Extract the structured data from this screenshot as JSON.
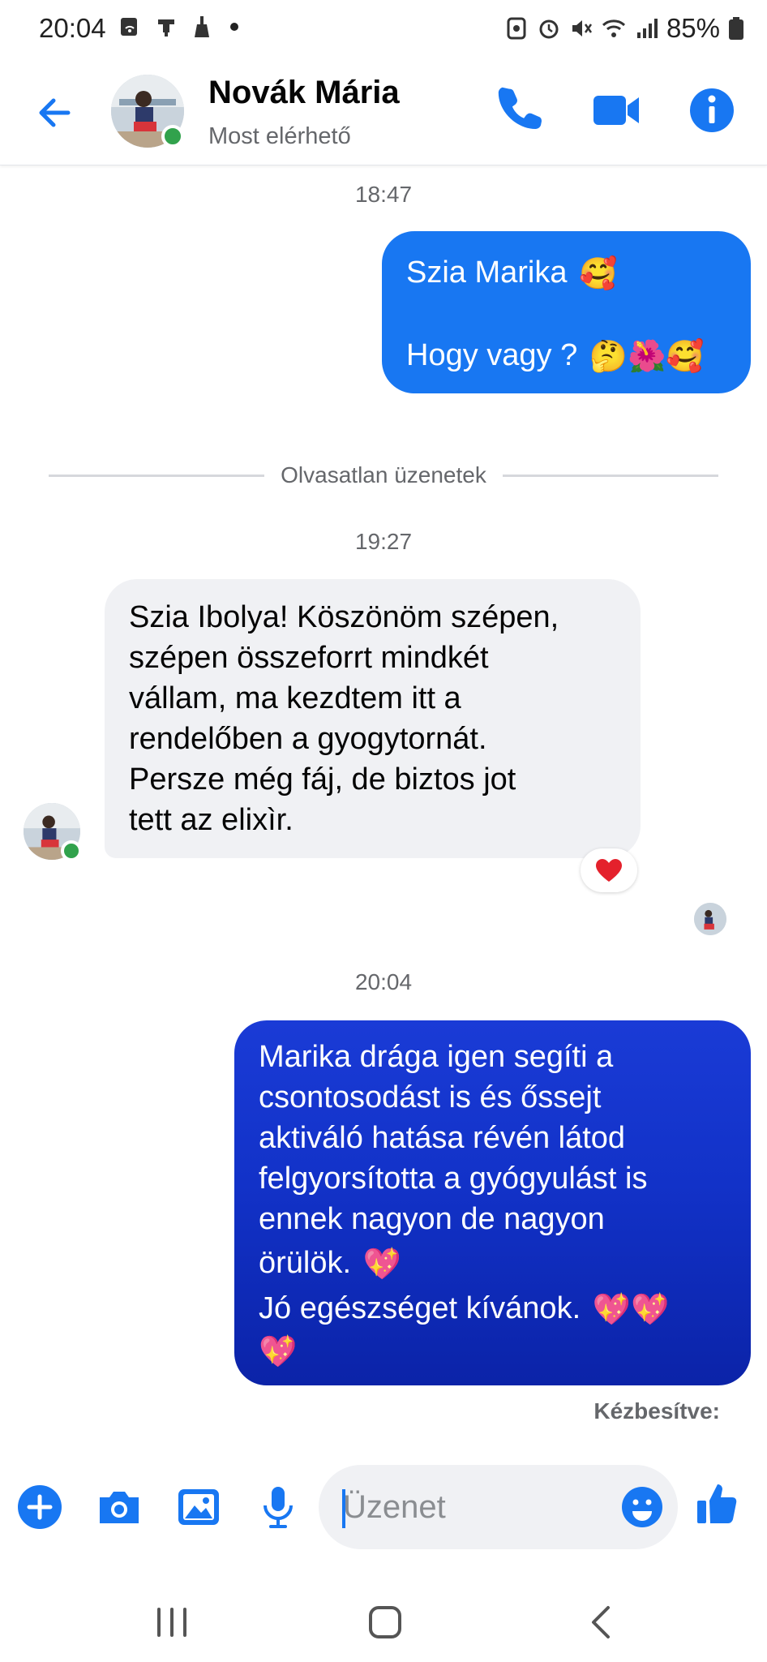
{
  "status_bar": {
    "time": "20:04",
    "battery": "85%",
    "icons": [
      "wifi-calling-icon",
      "download-icon",
      "broom-icon",
      "more-dot-icon",
      "nfc-icon",
      "alarm-icon",
      "mute-icon",
      "wifi-icon",
      "signal-icon",
      "battery-icon"
    ]
  },
  "header": {
    "contact_name": "Novák Mária",
    "contact_status": "Most elérhető",
    "buttons": [
      "back-arrow-icon",
      "phone-icon",
      "video-camera-icon",
      "info-icon"
    ],
    "accent_color": "#1877f2",
    "online_color": "#31a24c"
  },
  "chat": {
    "timestamp_1": "18:47",
    "msg_out_1": {
      "line1": "Szia Marika",
      "line1_emoji": "🥰",
      "line2": "Hogy vagy ?",
      "line2_emoji": "🤔🌺🥰"
    },
    "unread_divider": "Olvasatlan üzenetek",
    "timestamp_2": "19:27",
    "msg_in_1": {
      "lines": [
        "Szia Ibolya! Köszönöm szépen,",
        "szépen összeforrt mindkét",
        "vállam, ma kezdtem itt a",
        "rendelőben a gyogytornát.",
        "Persze még fáj, de biztos jot",
        "tett az elixìr."
      ],
      "reaction": "❤️"
    },
    "timestamp_3": "20:04",
    "msg_out_2": {
      "lines": [
        "Marika drága igen segíti a",
        "csontosodást is és  őssejt",
        "aktiváló hatása révén látod",
        "felgyorsította a gyógyulást is",
        "ennek nagyon de nagyon"
      ],
      "line6": "örülök.",
      "line6_emoji": "💖",
      "line7": "Jó egészséget kívánok.",
      "line7_emoji": "💖💖",
      "line8_emoji": "💖"
    },
    "delivery_status": "Kézbesítve:"
  },
  "composer": {
    "placeholder": "Üzenet",
    "buttons": [
      "plus-icon",
      "camera-icon",
      "gallery-icon",
      "microphone-icon",
      "emoji-icon",
      "thumbs-up-icon"
    ]
  },
  "navbar": {
    "buttons": [
      "recent-apps-icon",
      "home-icon",
      "back-icon"
    ]
  }
}
